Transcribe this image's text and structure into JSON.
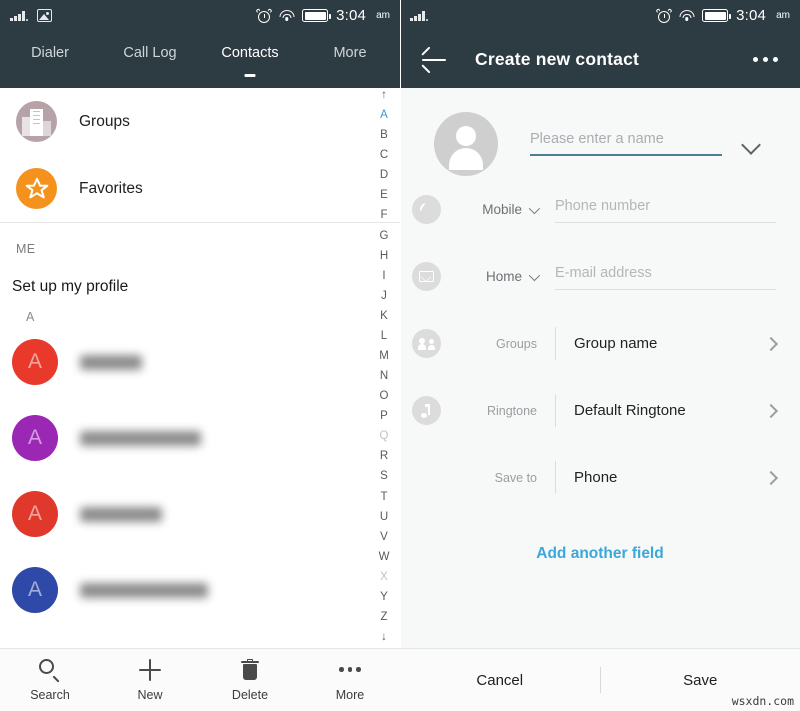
{
  "status_bar": {
    "left_icons": [
      "signal-bars-icon",
      "photo-icon"
    ],
    "right_icons": [
      "alarm-icon",
      "wifi-icon",
      "battery-icon"
    ],
    "time": "3:04",
    "ampm": "am"
  },
  "status_bar_right": {
    "left_icons": [
      "signal-bars-icon"
    ],
    "right_icons": [
      "alarm-icon",
      "wifi-icon",
      "battery-icon"
    ],
    "time": "3:04",
    "ampm": "am"
  },
  "left_panel": {
    "tabs": [
      {
        "label": "Dialer",
        "active": false
      },
      {
        "label": "Call Log",
        "active": false
      },
      {
        "label": "Contacts",
        "active": true
      },
      {
        "label": "More",
        "active": false
      }
    ],
    "shortcuts": [
      {
        "label": "Groups",
        "icon": "buildings-icon",
        "color": "#b6a3a8"
      },
      {
        "label": "Favorites",
        "icon": "star-icon",
        "color": "#f5921e"
      }
    ],
    "me_section": {
      "header": "ME",
      "profile_label": "Set up my profile"
    },
    "alpha_section_header": "A",
    "contacts": [
      {
        "initial": "A",
        "color": "#e8392b",
        "name_width": 62,
        "redacted": true
      },
      {
        "initial": "A",
        "color": "#9b27b5",
        "name_width": 121,
        "redacted": true
      },
      {
        "initial": "A",
        "color": "#e0392b",
        "name_width": 82,
        "redacted": true
      },
      {
        "initial": "A",
        "color": "#2f49a8",
        "name_width": 128,
        "redacted": true
      }
    ],
    "alpha_index": [
      {
        "label": "↑",
        "state": "normal"
      },
      {
        "label": "A",
        "state": "active"
      },
      {
        "label": "B",
        "state": "normal"
      },
      {
        "label": "C",
        "state": "normal"
      },
      {
        "label": "D",
        "state": "normal"
      },
      {
        "label": "E",
        "state": "normal"
      },
      {
        "label": "F",
        "state": "normal"
      },
      {
        "label": "G",
        "state": "normal"
      },
      {
        "label": "H",
        "state": "normal"
      },
      {
        "label": "I",
        "state": "normal"
      },
      {
        "label": "J",
        "state": "normal"
      },
      {
        "label": "K",
        "state": "normal"
      },
      {
        "label": "L",
        "state": "normal"
      },
      {
        "label": "M",
        "state": "normal"
      },
      {
        "label": "N",
        "state": "normal"
      },
      {
        "label": "O",
        "state": "normal"
      },
      {
        "label": "P",
        "state": "normal"
      },
      {
        "label": "Q",
        "state": "dim"
      },
      {
        "label": "R",
        "state": "normal"
      },
      {
        "label": "S",
        "state": "normal"
      },
      {
        "label": "T",
        "state": "normal"
      },
      {
        "label": "U",
        "state": "normal"
      },
      {
        "label": "V",
        "state": "normal"
      },
      {
        "label": "W",
        "state": "normal"
      },
      {
        "label": "X",
        "state": "dim"
      },
      {
        "label": "Y",
        "state": "normal"
      },
      {
        "label": "Z",
        "state": "normal"
      },
      {
        "label": "↓",
        "state": "normal"
      }
    ],
    "bottom_bar": [
      {
        "label": "Search",
        "icon": "search-icon"
      },
      {
        "label": "New",
        "icon": "plus-icon"
      },
      {
        "label": "Delete",
        "icon": "trash-icon"
      },
      {
        "label": "More",
        "icon": "more-dots-icon"
      }
    ]
  },
  "right_panel": {
    "app_bar": {
      "back_icon": "back-arrow-icon",
      "title": "Create new contact",
      "overflow_icon": "more-dots-icon"
    },
    "name_field": {
      "avatar_icon": "person-avatar-icon",
      "placeholder": "Please enter a name",
      "value": "",
      "expand_icon": "chevron-down-icon",
      "underline_color": "#4c7f94"
    },
    "fields": [
      {
        "icon": "phone-icon",
        "type_label": "Mobile",
        "has_type_chevron": true,
        "placeholder": "Phone number",
        "value": "",
        "kind": "input"
      },
      {
        "icon": "mail-icon",
        "type_label": "Home",
        "has_type_chevron": true,
        "placeholder": "E-mail address",
        "value": "",
        "kind": "input"
      },
      {
        "icon": "people-icon",
        "type_label": "Groups",
        "has_type_chevron": false,
        "value": "Group name",
        "kind": "nav",
        "nav_icon": "chevron-right-icon"
      },
      {
        "icon": "music-note-icon",
        "type_label": "Ringtone",
        "has_type_chevron": false,
        "value": "Default Ringtone",
        "kind": "nav",
        "nav_icon": "chevron-right-icon"
      },
      {
        "icon": "",
        "type_label": "Save to",
        "has_type_chevron": false,
        "value": "Phone",
        "kind": "nav",
        "nav_icon": "chevron-right-icon"
      }
    ],
    "add_another_field": {
      "label": "Add another field",
      "color": "#3aa8d8"
    },
    "bottom_bar": {
      "cancel_label": "Cancel",
      "save_label": "Save"
    }
  },
  "watermark": "wsxdn.com"
}
